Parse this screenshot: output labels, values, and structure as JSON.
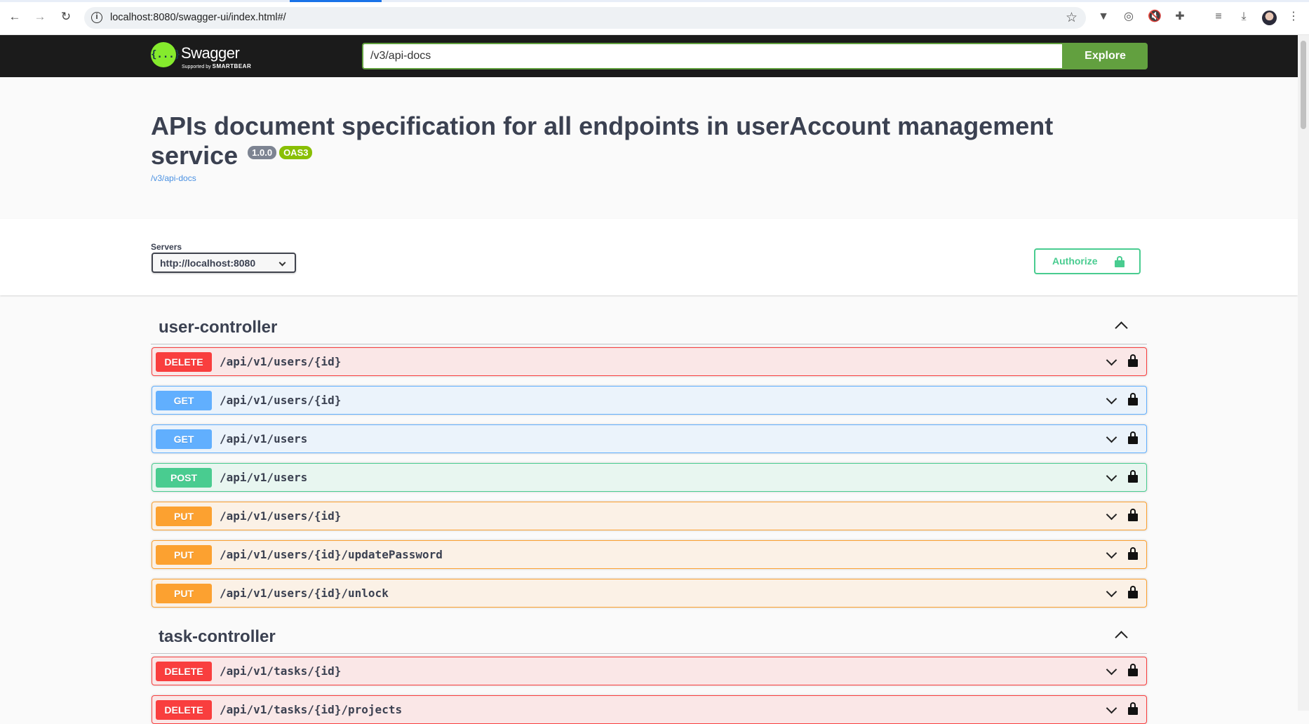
{
  "browser": {
    "url": "localhost:8080/swagger-ui/index.html#/"
  },
  "topbar": {
    "logo_name": "Swagger",
    "logo_sub_prefix": "Supported by",
    "logo_sub_brand": "SMARTBEAR",
    "search_value": "/v3/api-docs",
    "explore_label": "Explore"
  },
  "info": {
    "title": "APIs document specification for all endpoints in userAccount management service",
    "version": "1.0.0",
    "oas_badge": "OAS3",
    "spec_link": "/v3/api-docs"
  },
  "servers": {
    "label": "Servers",
    "selected": "http://localhost:8080",
    "authorize_label": "Authorize"
  },
  "tags": [
    {
      "name": "user-controller",
      "operations": [
        {
          "method": "DELETE",
          "path": "/api/v1/users/{id}"
        },
        {
          "method": "GET",
          "path": "/api/v1/users/{id}"
        },
        {
          "method": "GET",
          "path": "/api/v1/users"
        },
        {
          "method": "POST",
          "path": "/api/v1/users"
        },
        {
          "method": "PUT",
          "path": "/api/v1/users/{id}"
        },
        {
          "method": "PUT",
          "path": "/api/v1/users/{id}/updatePassword"
        },
        {
          "method": "PUT",
          "path": "/api/v1/users/{id}/unlock"
        }
      ]
    },
    {
      "name": "task-controller",
      "operations": [
        {
          "method": "DELETE",
          "path": "/api/v1/tasks/{id}"
        },
        {
          "method": "DELETE",
          "path": "/api/v1/tasks/{id}/projects"
        }
      ]
    }
  ],
  "colors": {
    "delete": "#f93e3e",
    "get": "#61affe",
    "post": "#49cc90",
    "put": "#fca130",
    "explore": "#62a03f"
  }
}
